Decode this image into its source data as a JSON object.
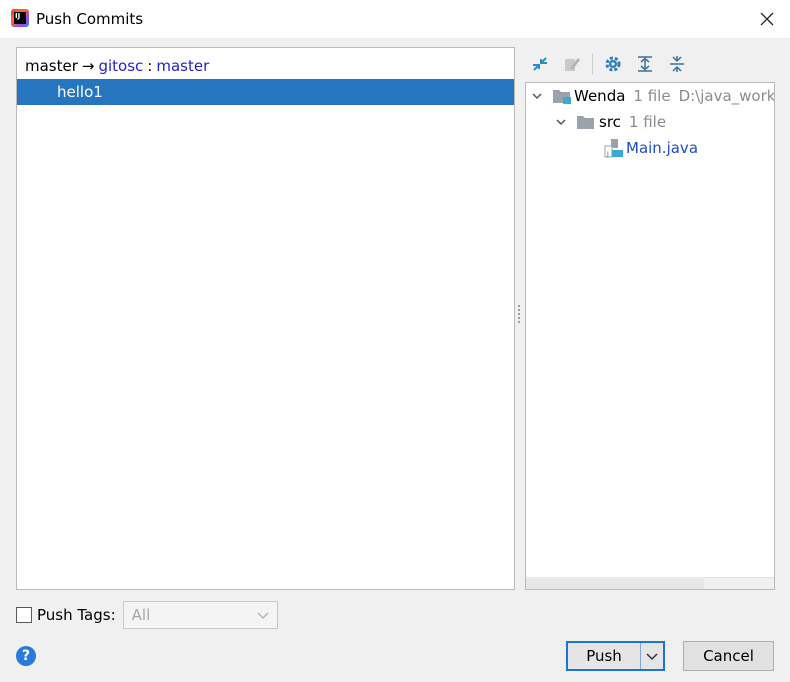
{
  "window": {
    "title": "Push Commits",
    "app_icon": "intellij-idea-icon",
    "app_icon_text": "IJ",
    "close_icon": "close-icon"
  },
  "commits_panel": {
    "local_branch": "master",
    "arrow": "→",
    "remote": "gitosc",
    "separator": ":",
    "remote_branch": "master",
    "commits": [
      {
        "message": "hello1",
        "selected": true
      }
    ],
    "selection_color": "#2675bf",
    "remote_color": "#2222cc"
  },
  "toolbar": {
    "buttons": [
      {
        "icon": "expand-diff-icon",
        "enabled": true
      },
      {
        "icon": "edit-source-icon",
        "enabled": false
      },
      {
        "icon": "settings-gear-icon",
        "enabled": true
      },
      {
        "icon": "expand-all-icon",
        "enabled": true
      },
      {
        "icon": "collapse-all-icon",
        "enabled": true
      }
    ]
  },
  "changes_tree": {
    "root": {
      "name": "Wenda",
      "count": "1 file",
      "path": "D:\\java_works",
      "icon": "module-folder-icon"
    },
    "folder": {
      "name": "src",
      "count": "1 file",
      "icon": "folder-icon"
    },
    "file": {
      "name": "Main.java",
      "icon": "java-file-icon"
    }
  },
  "footer": {
    "push_tags_label": "Push Tags:",
    "push_tags_checked": false,
    "tags_select_value": "All",
    "help_icon": "help-icon",
    "push_label": "Push",
    "cancel_label": "Cancel",
    "accent_color": "#1e73d6"
  }
}
